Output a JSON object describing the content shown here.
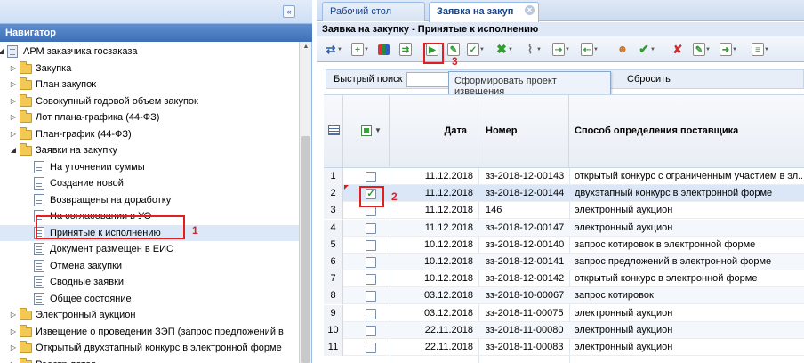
{
  "navigator": {
    "header": "Навигатор",
    "items": [
      {
        "label": "АРМ заказчика госзаказа",
        "type": "root"
      },
      {
        "label": "Закупка",
        "type": "folder"
      },
      {
        "label": "План закупок",
        "type": "folder"
      },
      {
        "label": "Совокупный годовой объем закупок",
        "type": "folder"
      },
      {
        "label": "Лот плана-графика (44-ФЗ)",
        "type": "folder"
      },
      {
        "label": "План-график (44-ФЗ)",
        "type": "folder"
      },
      {
        "label": "Заявки на закупку",
        "type": "folder-open"
      },
      {
        "label": "На уточнении суммы",
        "type": "doc"
      },
      {
        "label": "Создание новой",
        "type": "doc"
      },
      {
        "label": "Возвращены на доработку",
        "type": "doc"
      },
      {
        "label": "На согласовании в УО",
        "type": "doc"
      },
      {
        "label": "Принятые к исполнению",
        "type": "doc",
        "selected": true
      },
      {
        "label": "Документ размещен в ЕИС",
        "type": "doc"
      },
      {
        "label": "Отмена закупки",
        "type": "doc"
      },
      {
        "label": "Сводные заявки",
        "type": "doc"
      },
      {
        "label": "Общее состояние",
        "type": "doc"
      },
      {
        "label": "Электронный аукцион",
        "type": "folder"
      },
      {
        "label": "Извещение о проведении ЗЭП (запрос предложений в",
        "type": "folder"
      },
      {
        "label": "Открытый двухэтапный конкурс в электронной форме",
        "type": "folder"
      },
      {
        "label": "Реестр лотов",
        "type": "folder"
      }
    ]
  },
  "markers": {
    "one": "1",
    "two": "2",
    "three": "3"
  },
  "tabs": [
    {
      "label": "Рабочий стол"
    },
    {
      "label": "Заявка на закуп",
      "active": true,
      "close": "✕"
    }
  ],
  "panel_title": "Заявка на закупку - Принятые к исполнению",
  "toolbar": {
    "icons": [
      "sort-icon",
      "add-icon",
      "multi-color-icon",
      "move-icon",
      "generate-project-icon",
      "edit-icon",
      "approve-icon",
      "delete-icon",
      "attach-icon",
      "export-icon",
      "import-icon",
      "users-icon",
      "check-icon",
      "reject-icon",
      "doc-edit-icon",
      "send-icon",
      "more-icon"
    ]
  },
  "search": {
    "label": "Быстрый поиск",
    "value": "",
    "reset": "Сбросить"
  },
  "tooltip": "Сформировать проект извещения",
  "grid": {
    "headers": {
      "date": "Дата",
      "number": "Номер",
      "method": "Способ определения поставщика"
    },
    "rows": [
      {
        "n": "1",
        "checked": false,
        "date": "11.12.2018",
        "number": "зз-2018-12-00143",
        "method": "открытый конкурс с ограниченным участием в эл..."
      },
      {
        "n": "2",
        "checked": true,
        "date": "11.12.2018",
        "number": "зз-2018-12-00144",
        "method": "двухэтапный конкурс в электронной форме"
      },
      {
        "n": "3",
        "checked": false,
        "date": "11.12.2018",
        "number": "146",
        "method": "электронный аукцион"
      },
      {
        "n": "4",
        "checked": false,
        "date": "11.12.2018",
        "number": "зз-2018-12-00147",
        "method": "электронный аукцион"
      },
      {
        "n": "5",
        "checked": false,
        "date": "10.12.2018",
        "number": "зз-2018-12-00140",
        "method": "запрос котировок в электронной форме"
      },
      {
        "n": "6",
        "checked": false,
        "date": "10.12.2018",
        "number": "зз-2018-12-00141",
        "method": "запрос предложений в электронной форме"
      },
      {
        "n": "7",
        "checked": false,
        "date": "10.12.2018",
        "number": "зз-2018-12-00142",
        "method": "открытый конкурс в электронной форме"
      },
      {
        "n": "8",
        "checked": false,
        "date": "03.12.2018",
        "number": "зз-2018-10-00067",
        "method": "запрос котировок"
      },
      {
        "n": "9",
        "checked": false,
        "date": "03.12.2018",
        "number": "зз-2018-11-00075",
        "method": "электронный аукцион"
      },
      {
        "n": "10",
        "checked": false,
        "date": "22.11.2018",
        "number": "зз-2018-11-00080",
        "method": "электронный аукцион"
      },
      {
        "n": "11",
        "checked": false,
        "date": "22.11.2018",
        "number": "зз-2018-11-00083",
        "method": "электронный аукцион"
      }
    ]
  },
  "colors": {
    "accent": "#3e6fb6",
    "highlight": "#e02020",
    "selection": "#dce8f7"
  }
}
